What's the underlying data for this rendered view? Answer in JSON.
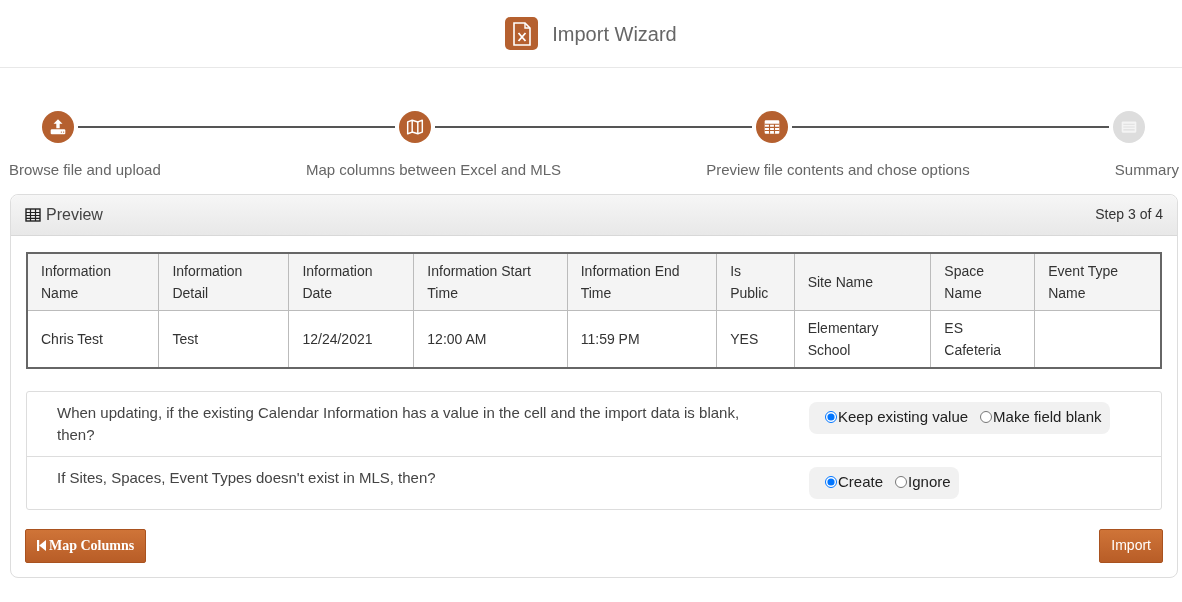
{
  "header": {
    "title": "Import Wizard"
  },
  "steps": [
    {
      "label": "Browse file and upload",
      "completed": true
    },
    {
      "label": "Map columns between Excel and MLS",
      "completed": true
    },
    {
      "label": "Preview file contents and chose options",
      "completed": true
    },
    {
      "label": "Summary",
      "completed": false
    }
  ],
  "panel": {
    "title": "Preview",
    "step": "Step 3 of 4"
  },
  "table": {
    "columns": [
      "Information Name",
      "Information Detail",
      "Information Date",
      "Information Start Time",
      "Information End Time",
      "Is Public",
      "Site Name",
      "Space Name",
      "Event Type Name"
    ],
    "rows": [
      [
        "Chris Test",
        "Test",
        "12/24/2021",
        "12:00 AM",
        "11:59 PM",
        "YES",
        "Elementary School",
        "ES Cafeteria",
        null
      ]
    ]
  },
  "options": [
    {
      "question": "When updating, if the existing Calendar Information has a value in the cell and the import data is blank, then?",
      "choices": [
        {
          "label": "Keep existing value",
          "selected": true
        },
        {
          "label": "Make field blank",
          "selected": false
        }
      ]
    },
    {
      "question": "If Sites, Spaces, Event Types doesn't exist in MLS, then?",
      "choices": [
        {
          "label": "Create",
          "selected": true
        },
        {
          "label": "Ignore",
          "selected": false
        }
      ]
    }
  ],
  "buttons": {
    "back": "Map Columns",
    "next": "Import"
  }
}
